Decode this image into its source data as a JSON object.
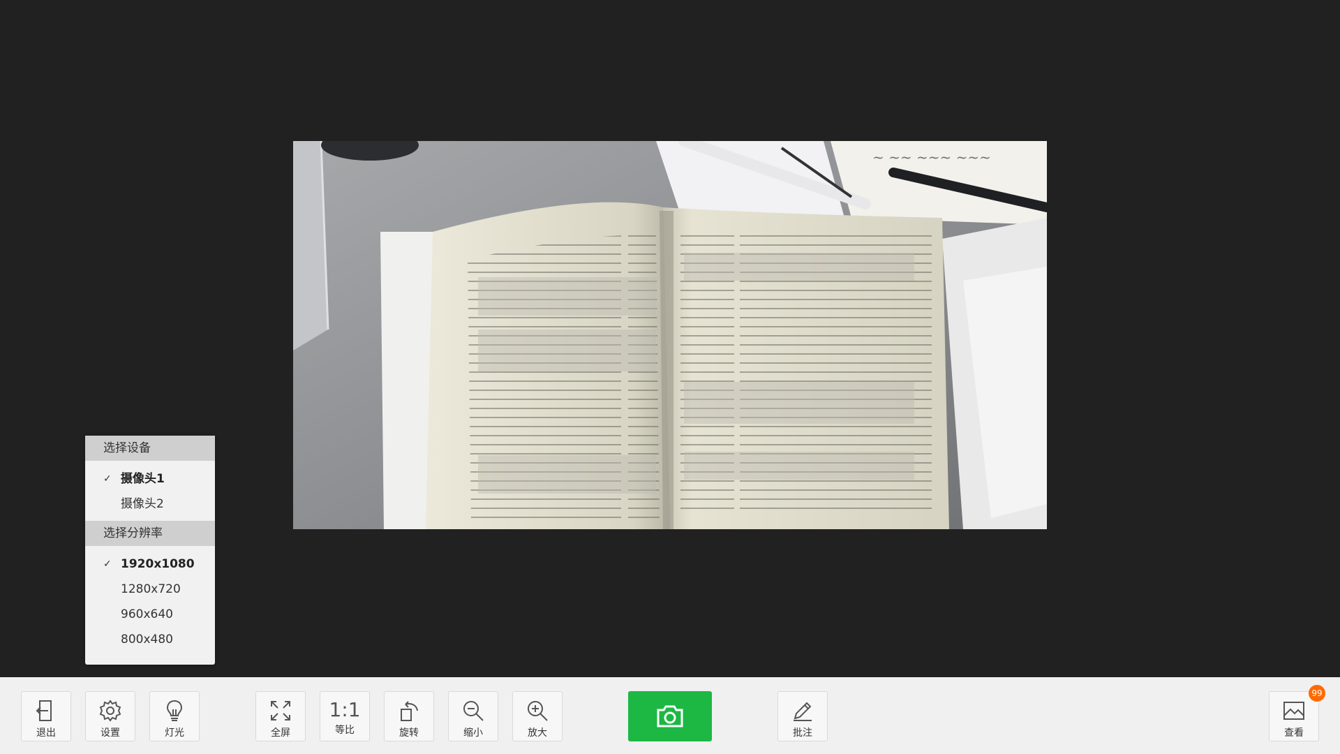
{
  "menu": {
    "device_header": "选择设备",
    "devices": [
      {
        "label": "摄像头1",
        "selected": true
      },
      {
        "label": "摄像头2",
        "selected": false
      }
    ],
    "resolution_header": "选择分辨率",
    "resolutions": [
      {
        "label": "1920x1080",
        "selected": true
      },
      {
        "label": "1280x720",
        "selected": false
      },
      {
        "label": "960x640",
        "selected": false
      },
      {
        "label": "800x480",
        "selected": false
      }
    ],
    "check_mark": "✓"
  },
  "toolbar": {
    "exit": "退出",
    "settings": "设置",
    "light": "灯光",
    "fullscreen": "全屏",
    "ratio_symbol": "1:1",
    "ratio": "等比",
    "rotate": "旋转",
    "zoom_out": "缩小",
    "zoom_in": "放大",
    "annotate": "批注",
    "view": "查看",
    "view_badge": "99"
  },
  "colors": {
    "background": "#212121",
    "toolbar": "#f0f0f0",
    "capture_button": "#1db844",
    "badge": "#ff6a00"
  }
}
